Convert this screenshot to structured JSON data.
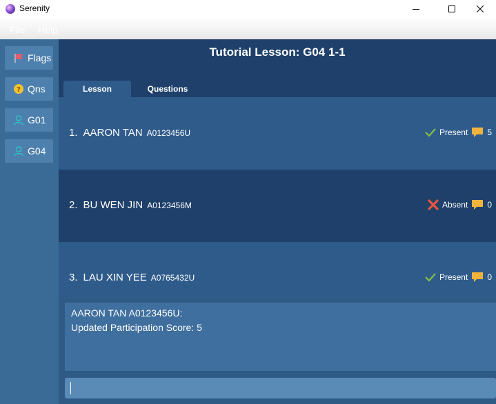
{
  "window": {
    "title": "Serenity",
    "controls": {
      "minimize": "minimize",
      "maximize": "maximize",
      "close": "close"
    }
  },
  "menu": {
    "items": [
      "File",
      "Help"
    ]
  },
  "sidebar": {
    "items": [
      {
        "label": "Flags",
        "icon": "flag-icon"
      },
      {
        "label": "Qns",
        "icon": "question-icon"
      },
      {
        "label": "G01",
        "icon": "user-icon"
      },
      {
        "label": "G04",
        "icon": "user-icon"
      }
    ]
  },
  "lesson": {
    "title": "Tutorial Lesson: G04 1-1",
    "tabs": [
      {
        "label": "Lesson",
        "selected": true
      },
      {
        "label": "Questions",
        "selected": false
      }
    ]
  },
  "students": [
    {
      "index": "1.",
      "name": "AARON TAN",
      "id": "A0123456U",
      "status": "Present",
      "status_icon": "check-icon",
      "score": "5"
    },
    {
      "index": "2.",
      "name": "BU WEN JIN",
      "id": "A0123456M",
      "status": "Absent",
      "status_icon": "cross-icon",
      "score": "0"
    },
    {
      "index": "3.",
      "name": "LAU XIN YEE",
      "id": "A0765432U",
      "status": "Present",
      "status_icon": "check-icon",
      "score": "0"
    }
  ],
  "result": {
    "line1": "AARON TAN A0123456U:",
    "line2": "Updated Participation Score: 5"
  },
  "command": {
    "value": ""
  },
  "colors": {
    "header_bg": "#1e406a",
    "row_light": "#2f5b8b",
    "sidebar_bg": "#3a6a96",
    "present": "#7fc241",
    "absent": "#e8563d",
    "score": "#f0b43c"
  }
}
